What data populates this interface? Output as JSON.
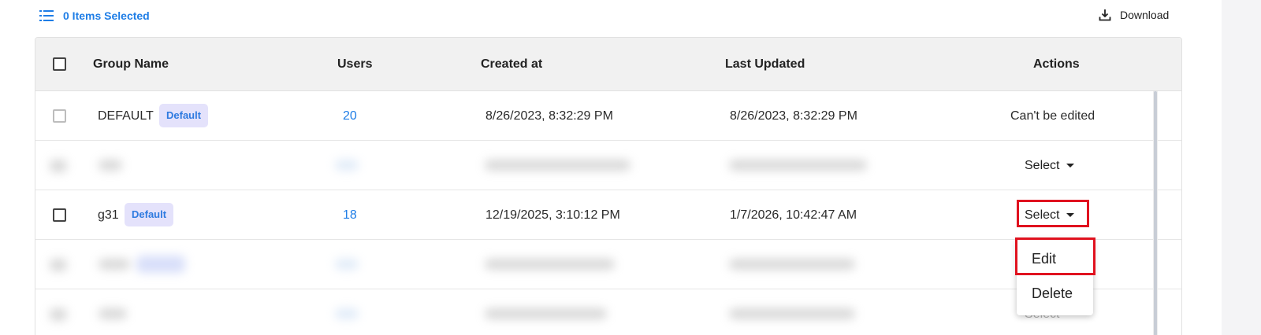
{
  "toolbar": {
    "selected_label": "0 Items Selected",
    "download_label": "Download"
  },
  "table": {
    "headers": {
      "group_name": "Group Name",
      "users": "Users",
      "created_at": "Created at",
      "last_updated": "Last Updated",
      "actions": "Actions"
    },
    "rows": [
      {
        "group_name": "DEFAULT",
        "badge": "Default",
        "users": "20",
        "created_at": "8/26/2023, 8:32:29 PM",
        "last_updated": "8/26/2023, 8:32:29 PM",
        "action": "Can't be edited"
      },
      {
        "action": "Select"
      },
      {
        "group_name": "g31",
        "badge": "Default",
        "users": "18",
        "created_at": "12/19/2025, 3:10:12 PM",
        "last_updated": "1/7/2026, 10:42:47 AM",
        "action": "Select"
      }
    ]
  },
  "dropdown": {
    "items": [
      "Edit",
      "Delete"
    ],
    "behind_label": "Select"
  },
  "colors": {
    "accent": "#1e7de6",
    "badge_bg": "#e4e2fb",
    "highlight": "#e0121f",
    "header_bg": "#f1f1f1"
  },
  "icons": {
    "list": "list-icon",
    "download": "download-icon",
    "caret": "caret-down-icon"
  }
}
